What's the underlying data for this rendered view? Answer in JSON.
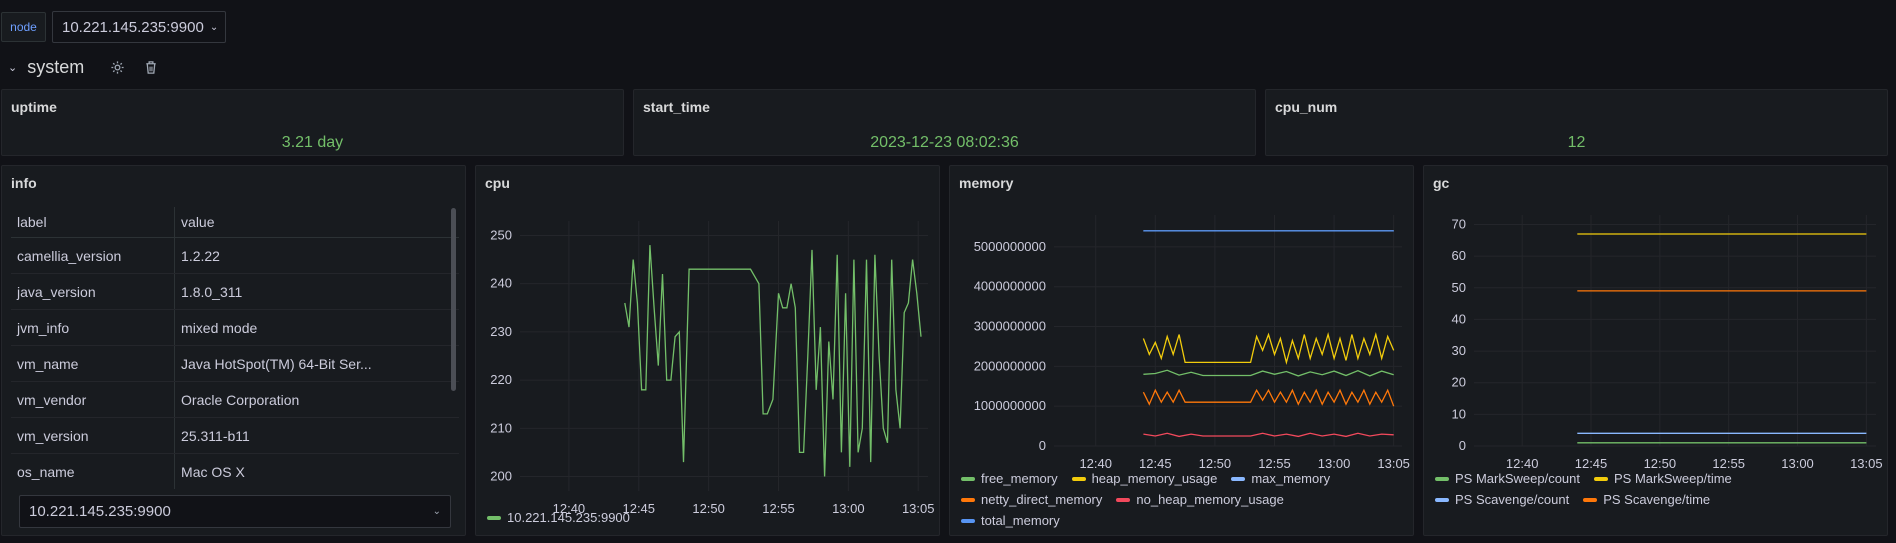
{
  "variables": {
    "label": "node",
    "value": "10.221.145.235:9900"
  },
  "row": {
    "title": "system"
  },
  "stats": [
    {
      "title": "uptime",
      "value": "3.21 day"
    },
    {
      "title": "start_time",
      "value": "2023-12-23 08:02:36"
    },
    {
      "title": "cpu_num",
      "value": "12"
    }
  ],
  "info": {
    "title": "info",
    "columns": [
      "label",
      "value"
    ],
    "rows": [
      [
        "camellia_version",
        "1.2.22"
      ],
      [
        "java_version",
        "1.8.0_311"
      ],
      [
        "jvm_info",
        "mixed mode"
      ],
      [
        "vm_name",
        "Java HotSpot(TM) 64-Bit Ser..."
      ],
      [
        "vm_vendor",
        "Oracle Corporation"
      ],
      [
        "vm_version",
        "25.311-b11"
      ],
      [
        "os_name",
        "Mac OS X"
      ]
    ],
    "select_value": "10.221.145.235:9900"
  },
  "colors": {
    "green": "#73bf69",
    "yellow": "#f2cc0c",
    "blue": "#8ab8ff",
    "orange": "#ff780a",
    "red": "#f2495c",
    "darkblue": "#5794f2"
  },
  "chart_data": [
    {
      "type": "line",
      "title": "cpu",
      "x_ticks": [
        "12:40",
        "12:45",
        "12:50",
        "12:55",
        "13:00",
        "13:05"
      ],
      "x_range_minutes": [
        36.5,
        65.7
      ],
      "ylim": [
        197,
        253
      ],
      "y_ticks": [
        200,
        210,
        220,
        230,
        240,
        250
      ],
      "series": [
        {
          "name": "10.221.145.235:9900",
          "color": "#73bf69",
          "x": [
            44,
            44.3,
            44.6,
            44.9,
            45.2,
            45.5,
            45.8,
            46.1,
            46.4,
            46.7,
            47,
            47.3,
            47.6,
            47.9,
            48.2,
            48.6,
            49,
            50,
            51,
            52,
            53,
            53.6,
            53.9,
            54.2,
            54.6,
            55,
            55.3,
            55.6,
            55.9,
            56.2,
            56.5,
            56.8,
            57.1,
            57.4,
            57.7,
            58,
            58.3,
            58.6,
            58.9,
            59.2,
            59.5,
            59.8,
            60.1,
            60.4,
            60.7,
            61,
            61.3,
            61.6,
            61.9,
            62.2,
            62.5,
            62.8,
            63.1,
            63.4,
            63.7,
            64,
            64.3,
            64.6,
            64.9,
            65.2
          ],
          "y": [
            236,
            231,
            245,
            236,
            218,
            218,
            248,
            235,
            223,
            242,
            220,
            220,
            229,
            230,
            203,
            243,
            243,
            243,
            243,
            243,
            243,
            240,
            213,
            213,
            216,
            238,
            235,
            235,
            240,
            235,
            205,
            205,
            225,
            247,
            218,
            231,
            200,
            228,
            216,
            246,
            205,
            238,
            202,
            245,
            205,
            210,
            245,
            203,
            246,
            225,
            210,
            207,
            245,
            218,
            210,
            234,
            236,
            245,
            238,
            229
          ]
        }
      ]
    },
    {
      "type": "line",
      "title": "memory",
      "x_ticks": [
        "12:40",
        "12:45",
        "12:50",
        "12:55",
        "13:00",
        "13:05"
      ],
      "x_range_minutes": [
        36.5,
        65.7
      ],
      "ylim": [
        0,
        5800000000
      ],
      "y_ticks": [
        "0",
        "1000000000",
        "2000000000",
        "3000000000",
        "4000000000",
        "5000000000"
      ],
      "series": [
        {
          "name": "free_memory",
          "color": "#73bf69",
          "x": [
            44,
            45,
            46,
            47,
            48,
            49,
            51,
            53,
            54,
            55,
            56,
            57,
            58,
            59,
            60,
            61,
            62,
            63,
            64,
            65
          ],
          "y": [
            1800000000,
            1820000000,
            1900000000,
            1780000000,
            1850000000,
            1770000000,
            1770000000,
            1770000000,
            1880000000,
            1800000000,
            1870000000,
            1760000000,
            1860000000,
            1790000000,
            1880000000,
            1770000000,
            1890000000,
            1760000000,
            1880000000,
            1790000000
          ]
        },
        {
          "name": "heap_memory_usage",
          "color": "#f2cc0c",
          "x": [
            44,
            44.5,
            45,
            45.5,
            46,
            46.5,
            47,
            47.5,
            48,
            49,
            51,
            53,
            53.5,
            54,
            54.5,
            55,
            55.5,
            56,
            56.5,
            57,
            57.5,
            58,
            58.5,
            59,
            59.5,
            60,
            60.5,
            61,
            61.5,
            62,
            62.5,
            63,
            63.5,
            64,
            64.5,
            65
          ],
          "y": [
            2700000000,
            2300000000,
            2600000000,
            2200000000,
            2750000000,
            2300000000,
            2800000000,
            2100000000,
            2100000000,
            2100000000,
            2100000000,
            2100000000,
            2750000000,
            2400000000,
            2800000000,
            2300000000,
            2700000000,
            2100000000,
            2650000000,
            2200000000,
            2800000000,
            2200000000,
            2700000000,
            2300000000,
            2800000000,
            2200000000,
            2700000000,
            2150000000,
            2800000000,
            2200000000,
            2700000000,
            2300000000,
            2800000000,
            2200000000,
            2750000000,
            2400000000
          ]
        },
        {
          "name": "max_memory",
          "color": "#8ab8ff",
          "x": [
            44,
            65
          ],
          "y": [
            5400000000,
            5400000000
          ]
        },
        {
          "name": "netty_direct_memory",
          "color": "#ff780a",
          "x": [
            44,
            44.5,
            45,
            45.5,
            46,
            46.5,
            47,
            47.5,
            48,
            49,
            51,
            53,
            53.5,
            54,
            54.5,
            55,
            55.5,
            56,
            56.5,
            57,
            57.5,
            58,
            58.5,
            59,
            59.5,
            60,
            60.5,
            61,
            61.5,
            62,
            62.5,
            63,
            63.5,
            64,
            64.5,
            65
          ],
          "y": [
            1350000000,
            1050000000,
            1400000000,
            1100000000,
            1350000000,
            1100000000,
            1400000000,
            1100000000,
            1100000000,
            1100000000,
            1100000000,
            1100000000,
            1400000000,
            1150000000,
            1400000000,
            1100000000,
            1350000000,
            1100000000,
            1400000000,
            1050000000,
            1350000000,
            1100000000,
            1400000000,
            1050000000,
            1350000000,
            1100000000,
            1400000000,
            1050000000,
            1350000000,
            1100000000,
            1400000000,
            1050000000,
            1350000000,
            1100000000,
            1400000000,
            1000000000
          ]
        },
        {
          "name": "no_heap_memory_usage",
          "color": "#f2495c",
          "x": [
            44,
            45,
            46,
            47,
            48,
            49,
            51,
            53,
            54,
            55,
            56,
            57,
            58,
            59,
            60,
            61,
            62,
            63,
            64,
            65
          ],
          "y": [
            300000000,
            250000000,
            320000000,
            240000000,
            300000000,
            250000000,
            250000000,
            250000000,
            320000000,
            250000000,
            300000000,
            240000000,
            320000000,
            250000000,
            300000000,
            240000000,
            320000000,
            250000000,
            300000000,
            280000000
          ]
        },
        {
          "name": "total_memory",
          "color": "#5794f2",
          "x": [
            44,
            65
          ],
          "y": [
            5400000000,
            5400000000
          ]
        }
      ]
    },
    {
      "type": "line",
      "title": "gc",
      "x_ticks": [
        "12:40",
        "12:45",
        "12:50",
        "12:55",
        "13:00",
        "13:05"
      ],
      "x_range_minutes": [
        36.5,
        65.7
      ],
      "ylim": [
        0,
        73
      ],
      "y_ticks": [
        0,
        10,
        20,
        30,
        40,
        50,
        60,
        70
      ],
      "series": [
        {
          "name": "PS MarkSweep/count",
          "color": "#73bf69",
          "x": [
            44,
            65
          ],
          "y": [
            1,
            1
          ]
        },
        {
          "name": "PS MarkSweep/time",
          "color": "#f2cc0c",
          "x": [
            44,
            65
          ],
          "y": [
            67,
            67
          ]
        },
        {
          "name": "PS Scavenge/count",
          "color": "#8ab8ff",
          "x": [
            44,
            65
          ],
          "y": [
            4,
            4
          ]
        },
        {
          "name": "PS Scavenge/time",
          "color": "#ff780a",
          "x": [
            44,
            65
          ],
          "y": [
            49,
            49
          ]
        }
      ]
    }
  ]
}
